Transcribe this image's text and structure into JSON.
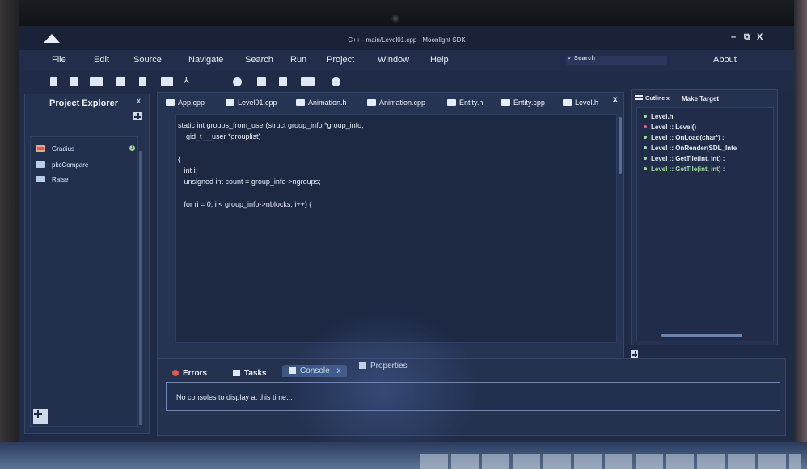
{
  "window": {
    "title": "C++ - main/Level01.cpp - Moonlight SDK",
    "controls": {
      "minimize": "–",
      "restore": "⧉",
      "close": "X"
    }
  },
  "menu": {
    "items": [
      "File",
      "Edit",
      "Source",
      "Navigate",
      "Search",
      "Run",
      "Project",
      "Window",
      "Help"
    ],
    "search_label": "Search",
    "about": "About"
  },
  "toolbar": {
    "icons": [
      "file-icon",
      "bookmark-icon",
      "books-icon",
      "print-icon",
      "clipboard-icon",
      "folder-icon",
      "share-icon",
      "user-icon",
      "document-icon",
      "save-icon",
      "screen-icon",
      "globe-icon"
    ]
  },
  "explorer": {
    "title": "Project Explorer",
    "close": "x",
    "items": [
      {
        "label": "Gradius",
        "badge": "1"
      },
      {
        "label": "pkcCompare"
      },
      {
        "label": "Raise"
      }
    ]
  },
  "editor": {
    "tabs": [
      "App.cpp",
      "Level01.cpp",
      "Animation.h",
      "Animation.cpp",
      "Entity.h",
      "Entity.cpp",
      "Level.h"
    ],
    "close": "x",
    "code": [
      "static int groups_from_user(struct group_info *group_info,",
      "    gid_t __user *grouplist)",
      "",
      "{",
      "   int i;",
      "   unsigned int count = group_info->ngroups;",
      "",
      "   for (i = 0; i < group_info->nblocks; i++) {"
    ]
  },
  "outline": {
    "tabs": [
      "Outline x",
      "Make Target"
    ],
    "items": [
      {
        "label": "Level.h",
        "color": "#9fdc9a"
      },
      {
        "label": "Level :: Level()",
        "color": "#e05a8a"
      },
      {
        "label": "Level :: OnLoad(char*)   :",
        "color": "#9fdc9a"
      },
      {
        "label": "Level :: OnRender(SDL_Inte",
        "color": "#9fdc9a"
      },
      {
        "label": "Level :: GetTile(int, int)   :",
        "color": "#9fdc9a"
      },
      {
        "label": "Level :: GetTile(int, int)   :",
        "color": "#9fdc9a"
      }
    ]
  },
  "bottom": {
    "tabs": [
      "Errors",
      "Tasks",
      "Console",
      "Properties"
    ],
    "console_close": "x",
    "message": "No consoles to display at this time..."
  },
  "colors": {
    "background": "#1f2b46",
    "accent": "#3c5680",
    "error": "#e0584e",
    "ok": "#9fdc9a"
  }
}
